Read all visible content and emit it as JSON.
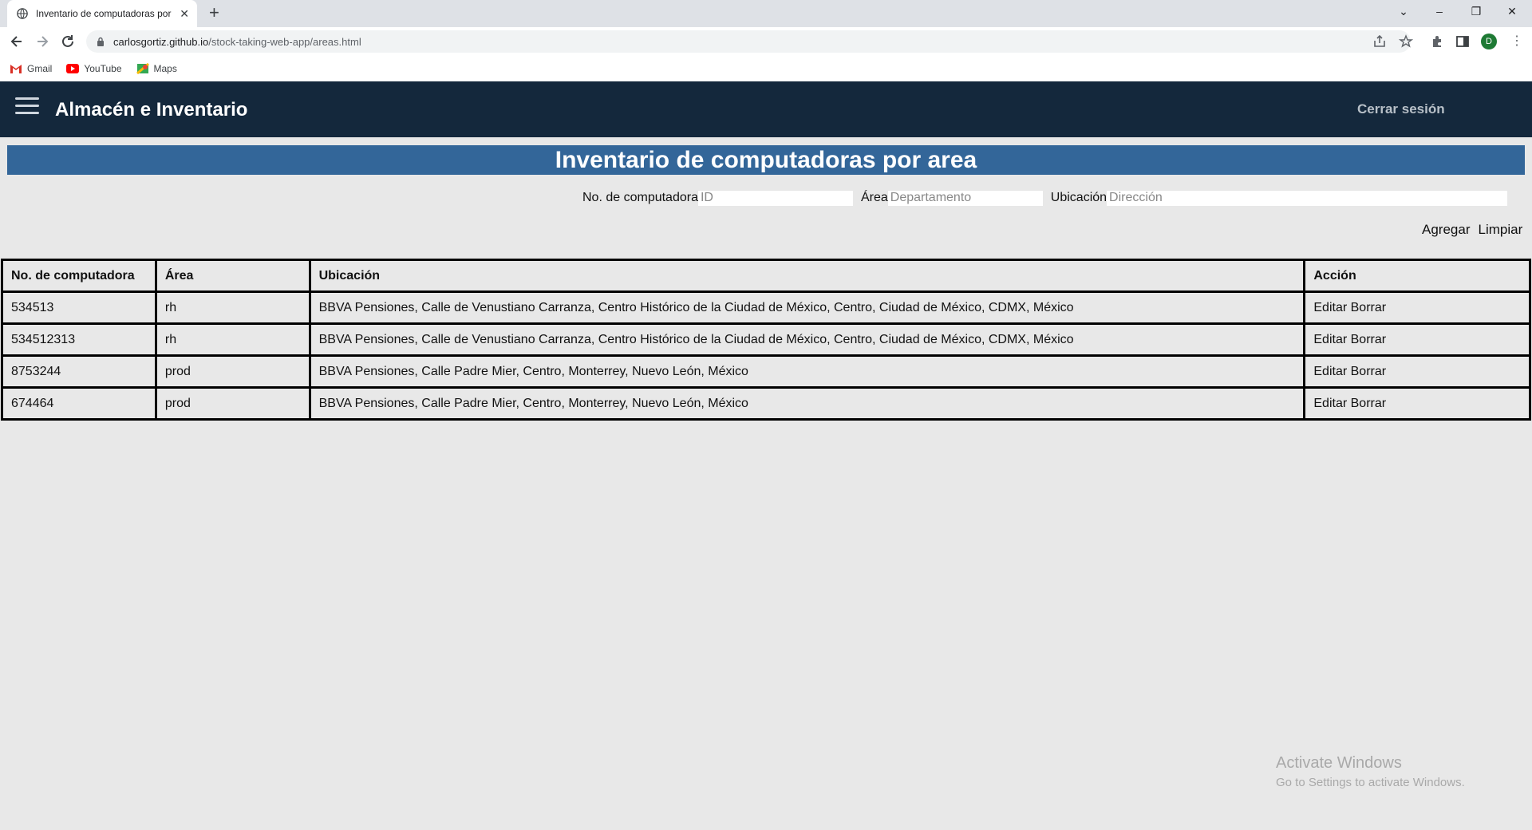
{
  "browser": {
    "tab_title": "Inventario de computadoras por",
    "url_host": "carlosgortiz.github.io",
    "url_path": "/stock-taking-web-app/areas.html",
    "profile_initial": "D",
    "bookmarks": [
      {
        "label": "Gmail",
        "icon": "gmail-icon"
      },
      {
        "label": "YouTube",
        "icon": "youtube-icon"
      },
      {
        "label": "Maps",
        "icon": "maps-icon"
      }
    ]
  },
  "header": {
    "title": "Almacén e Inventario",
    "logout": "Cerrar sesión"
  },
  "page": {
    "banner": "Inventario de computadoras por area"
  },
  "form": {
    "id_label": "No. de computadora",
    "id_placeholder": "ID",
    "area_label": "Área",
    "area_placeholder": "Departamento",
    "location_label": "Ubicación",
    "location_placeholder": "Dirección",
    "add_label": "Agregar",
    "clear_label": "Limpiar"
  },
  "table": {
    "headers": [
      "No. de computadora",
      "Área",
      "Ubicación",
      "Acción"
    ],
    "edit_label": "Editar",
    "delete_label": "Borrar",
    "rows": [
      {
        "id": "534513",
        "area": "rh",
        "location": "BBVA Pensiones, Calle de Venustiano Carranza, Centro Histórico de la Ciudad de México, Centro, Ciudad de México, CDMX, México"
      },
      {
        "id": "534512313",
        "area": "rh",
        "location": "BBVA Pensiones, Calle de Venustiano Carranza, Centro Histórico de la Ciudad de México, Centro, Ciudad de México, CDMX, México"
      },
      {
        "id": "8753244",
        "area": "prod",
        "location": "BBVA Pensiones, Calle Padre Mier, Centro, Monterrey, Nuevo León, México"
      },
      {
        "id": "674464",
        "area": "prod",
        "location": "BBVA Pensiones, Calle Padre Mier, Centro, Monterrey, Nuevo León, México"
      }
    ]
  },
  "watermark": {
    "line1": "Activate Windows",
    "line2": "Go to Settings to activate Windows."
  }
}
